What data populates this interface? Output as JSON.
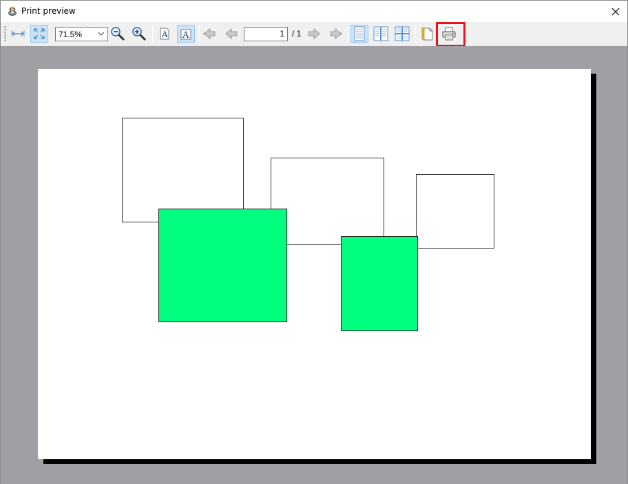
{
  "window": {
    "title": "Print preview"
  },
  "toolbar": {
    "zoom_value": "71.5%",
    "zoom_options": [
      "71.5%"
    ],
    "current_page": "1",
    "page_total": "/ 1"
  },
  "colors": {
    "shape_fill": "#00ff7f",
    "highlight": "#e8141c",
    "viewport_bg": "#a0a0a4"
  },
  "icons": [
    "window-logo-icon",
    "close-icon",
    "page-width-icon",
    "whole-page-icon",
    "zoom-out-icon",
    "zoom-in-icon",
    "font-small-icon",
    "font-large-icon",
    "first-page-icon",
    "previous-page-icon",
    "next-page-icon",
    "last-page-icon",
    "single-page-icon",
    "two-pages-icon",
    "four-pages-icon",
    "page-setup-icon",
    "print-icon"
  ]
}
